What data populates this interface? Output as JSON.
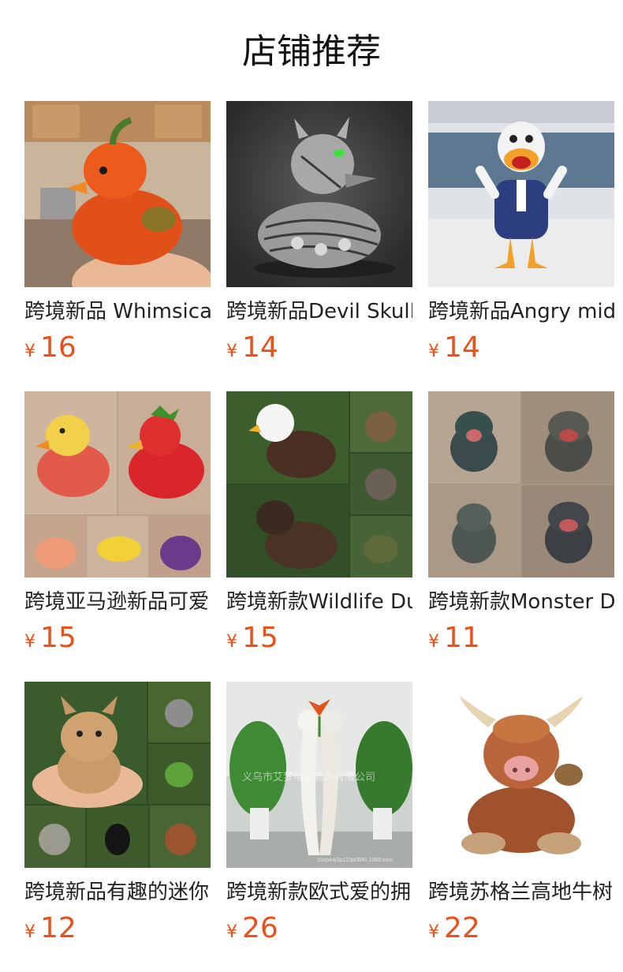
{
  "page": {
    "title": "店铺推荐"
  },
  "products": [
    {
      "title": "跨境新品 Whimsical",
      "currency": "¥",
      "price": "16",
      "image": "pepper-duck-figurine"
    },
    {
      "title": "跨境新品Devil Skull",
      "currency": "¥",
      "price": "14",
      "image": "skull-duck-figurine"
    },
    {
      "title": "跨境新品Angry mid",
      "currency": "¥",
      "price": "14",
      "image": "angry-duck-figurine"
    },
    {
      "title": "跨境亚马逊新品可爱",
      "currency": "¥",
      "price": "15",
      "image": "fruit-duck-figurines"
    },
    {
      "title": "跨境新款Wildlife Du",
      "currency": "¥",
      "price": "15",
      "image": "wildlife-duck-figurines"
    },
    {
      "title": "跨境新款Monster D",
      "currency": "¥",
      "price": "11",
      "image": "monster-dog-figurines"
    },
    {
      "title": "跨境新品有趣的迷你",
      "currency": "¥",
      "price": "12",
      "image": "mini-animal-figurines"
    },
    {
      "title": "跨境新款欧式爱的拥",
      "currency": "¥",
      "price": "26",
      "image": "hug-vase-sculpture"
    },
    {
      "title": "跨境苏格兰高地牛树",
      "currency": "¥",
      "price": "22",
      "image": "highland-cow-figurine"
    }
  ],
  "watermark": {
    "text": "义乌市艾梦电子商务有限公司",
    "shop": "shop44j3p123p0840.1688.com"
  }
}
